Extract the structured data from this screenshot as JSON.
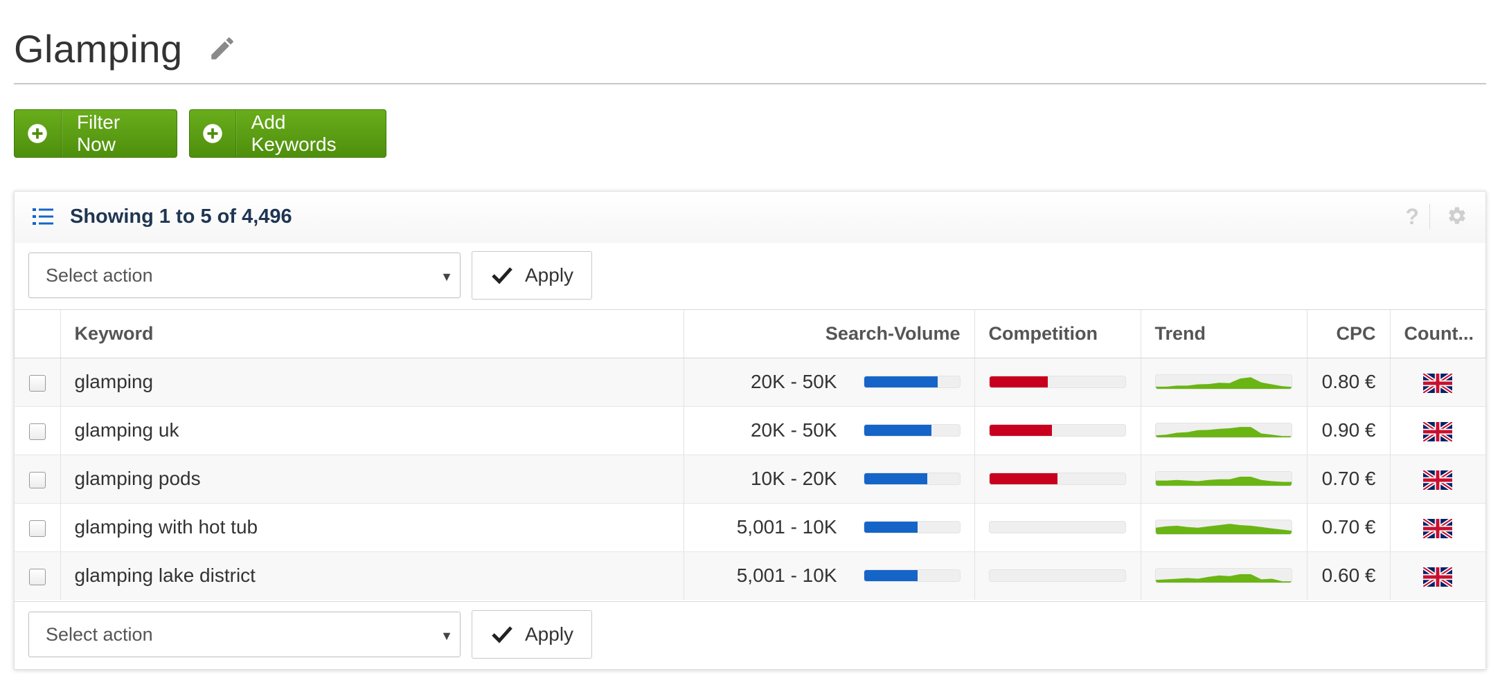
{
  "page": {
    "title": "Glamping"
  },
  "buttons": {
    "filter_now": "Filter Now",
    "add_keywords": "Add Keywords"
  },
  "panel": {
    "showing": "Showing 1 to 5 of 4,496",
    "help_glyph": "?"
  },
  "action_bar": {
    "select_placeholder": "Select action",
    "apply_label": "Apply"
  },
  "table": {
    "columns": [
      "Keyword",
      "Search-Volume",
      "Competition",
      "Trend",
      "CPC",
      "Count..."
    ],
    "rows": [
      {
        "keyword": "glamping",
        "search_volume": "20K - 50K",
        "volume_fill": 0.77,
        "competition_fill": 0.43,
        "trend": [
          0.22,
          0.22,
          0.3,
          0.3,
          0.4,
          0.42,
          0.52,
          0.5,
          0.85,
          0.95,
          0.55,
          0.4,
          0.25,
          0.2
        ],
        "cpc": "0.80 €",
        "country": "uk-flag"
      },
      {
        "keyword": "glamping uk",
        "search_volume": "20K - 50K",
        "volume_fill": 0.71,
        "competition_fill": 0.46,
        "trend": [
          0.2,
          0.25,
          0.4,
          0.45,
          0.6,
          0.62,
          0.7,
          0.75,
          0.85,
          0.85,
          0.35,
          0.25,
          0.15,
          0.15
        ],
        "cpc": "0.90 €",
        "country": "uk-flag"
      },
      {
        "keyword": "glamping pods",
        "search_volume": "10K - 20K",
        "volume_fill": 0.66,
        "competition_fill": 0.5,
        "trend": [
          0.45,
          0.45,
          0.5,
          0.45,
          0.4,
          0.5,
          0.55,
          0.55,
          0.75,
          0.75,
          0.5,
          0.4,
          0.35,
          0.35
        ],
        "cpc": "0.70 €",
        "country": "uk-flag"
      },
      {
        "keyword": "glamping with hot tub",
        "search_volume": "5,001 - 10K",
        "volume_fill": 0.56,
        "competition_fill": 0.0,
        "trend": [
          0.55,
          0.65,
          0.7,
          0.6,
          0.55,
          0.65,
          0.75,
          0.85,
          0.75,
          0.7,
          0.6,
          0.5,
          0.4,
          0.3
        ],
        "cpc": "0.70 €",
        "country": "uk-flag"
      },
      {
        "keyword": "glamping lake district",
        "search_volume": "5,001 - 10K",
        "volume_fill": 0.56,
        "competition_fill": 0.0,
        "trend": [
          0.25,
          0.3,
          0.35,
          0.4,
          0.35,
          0.5,
          0.6,
          0.55,
          0.7,
          0.7,
          0.3,
          0.35,
          0.15,
          0.15
        ],
        "cpc": "0.60 €",
        "country": "uk-flag"
      }
    ]
  },
  "colors": {
    "volume_bar": "#1565c8",
    "competition_bar": "#c8001e",
    "trend_fill": "#6ab514",
    "button_green": "#5a9c14",
    "link_blue": "#1565c8"
  }
}
